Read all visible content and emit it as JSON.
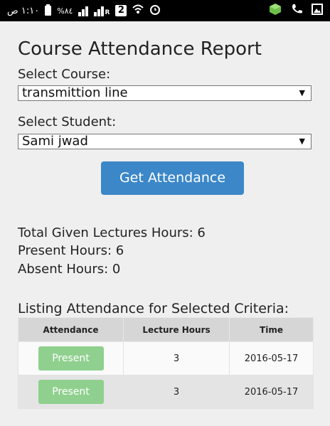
{
  "statusbar": {
    "time": "١:١٠ ص",
    "battery_percent": "%٨٤",
    "sim_badge": "2",
    "signal_r": "R",
    "colors": {
      "background": "#000000",
      "icons": "#ffffff"
    }
  },
  "page": {
    "title": "Course Attendance Report",
    "course_label": "Select Course:",
    "course_value": "transmittion line",
    "student_label": "Select Student:",
    "student_value": "Sami jwad",
    "get_button": "Get Attendance",
    "total_hours": "Total Given Lectures Hours: 6",
    "present_hours": "Present Hours: 6",
    "absent_hours": "Absent Hours: 0",
    "listing_heading": "Listing Attendance for Selected Criteria:",
    "accent": "#3b87c8",
    "present_color": "#8fd08f"
  },
  "table": {
    "headers": [
      "Attendance",
      "Lecture Hours",
      "Time"
    ],
    "rows": [
      {
        "status": "Present",
        "hours": "3",
        "time": "2016-05-17"
      },
      {
        "status": "Present",
        "hours": "3",
        "time": "2016-05-17"
      }
    ]
  }
}
